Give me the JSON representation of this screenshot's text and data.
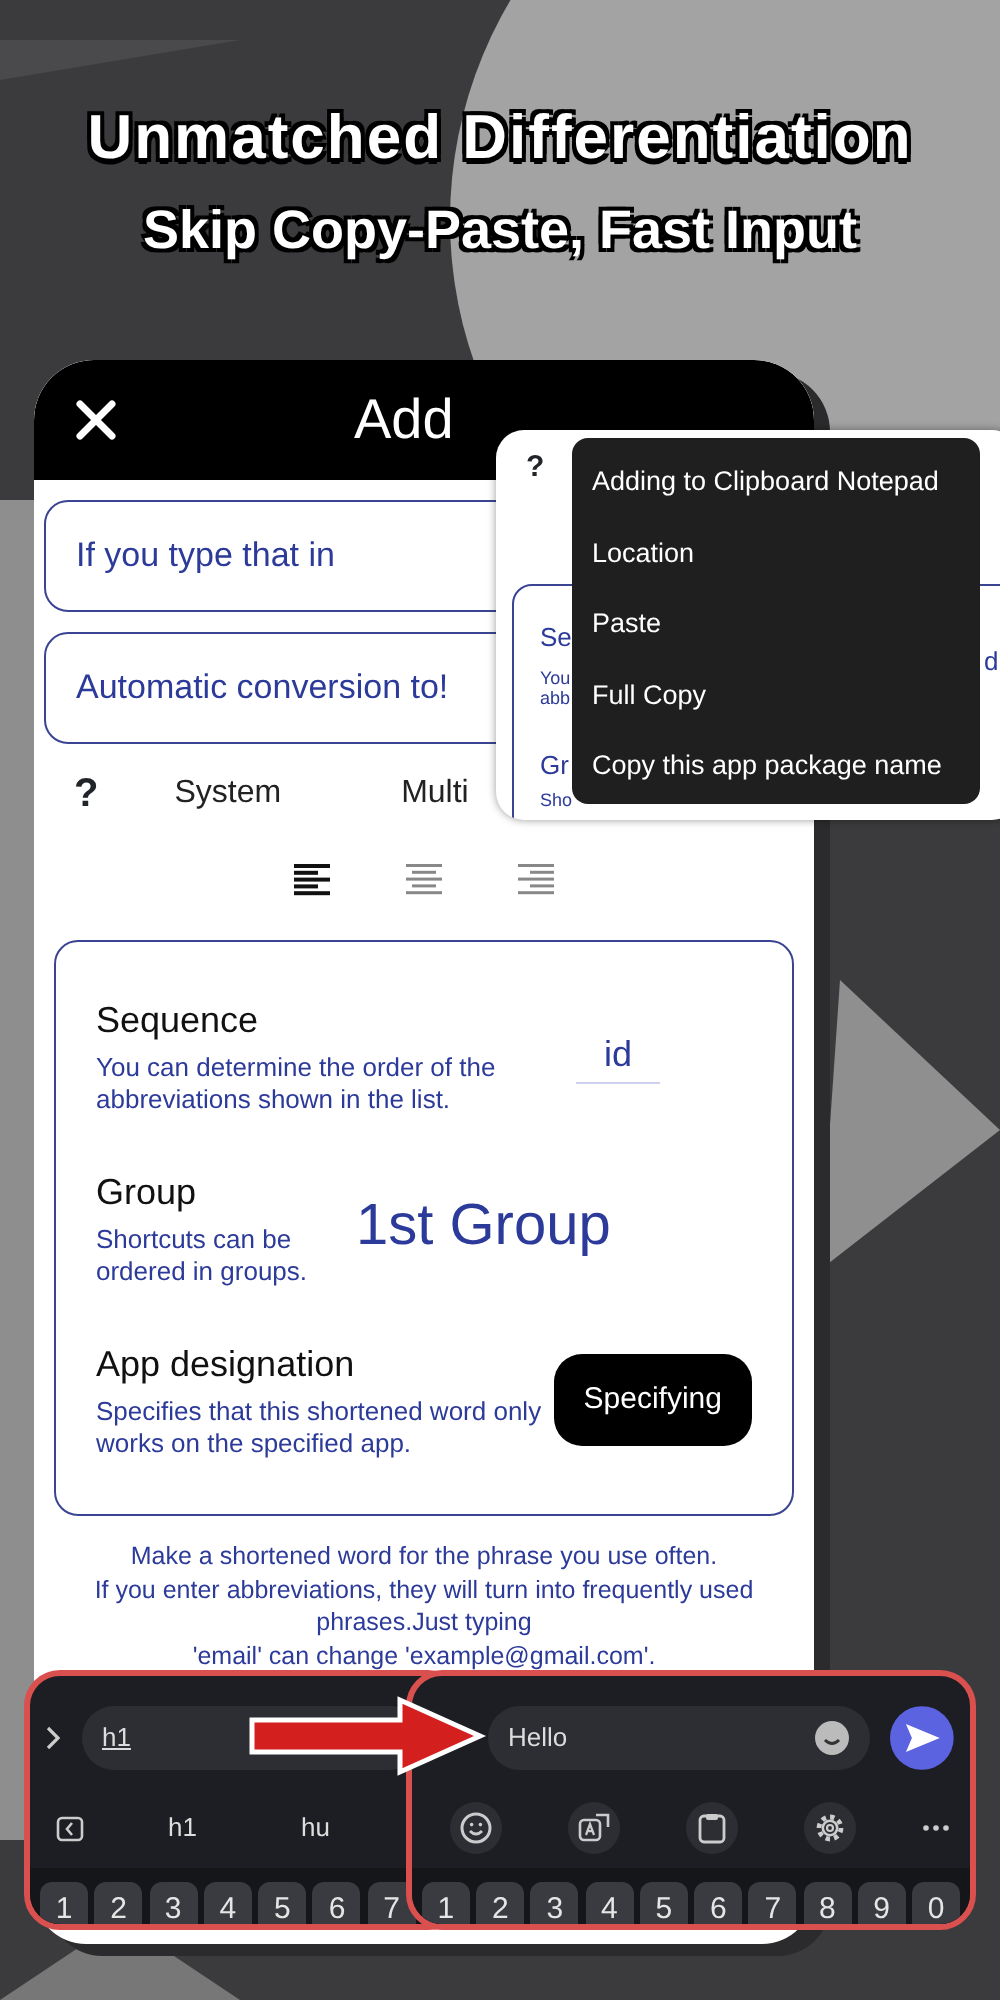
{
  "banner": {
    "title": "Unmatched Differentiation",
    "subtitle": "Skip Copy-Paste, Fast Input"
  },
  "dialog": {
    "title": "Add",
    "fields": [
      {
        "placeholder": "If you type that in"
      },
      {
        "placeholder": "Automatic conversion to!"
      }
    ],
    "help": "?",
    "tabs": [
      {
        "label": "System"
      },
      {
        "label": "Multi"
      }
    ],
    "alignments": [
      {
        "kind": "left",
        "selected": true
      },
      {
        "kind": "center",
        "selected": false
      },
      {
        "kind": "right",
        "selected": false
      }
    ],
    "settings": [
      {
        "kind": "field",
        "title": "Sequence",
        "description": "You can determine the order of the abbreviations shown in the list.",
        "value": "id"
      },
      {
        "kind": "big",
        "title": "Group",
        "description": "Shortcuts can be ordered in groups.",
        "value": "1st Group"
      },
      {
        "kind": "button",
        "title": "App designation",
        "description": "Specifies that this shortened word only works on the specified app.",
        "value": "Specifying"
      }
    ],
    "help_text": "Make a shortened word for the phrase you use often.\nIf you enter abbreviations, they will turn into frequently used phrases.Just typing\n'email' can change 'example@gmail.com'."
  },
  "popup": {
    "help": "?",
    "fragments": [
      "Se",
      "You",
      "abb",
      "Gr",
      "Sho",
      "d"
    ],
    "menu": [
      "Adding to Clipboard Notepad",
      "Location",
      "Paste",
      "Full Copy",
      "Copy this app package name"
    ]
  },
  "keyboards": [
    {
      "kind": "suggest",
      "text": "h1",
      "suggestions": [
        "h1",
        "hu"
      ],
      "keys": [
        "1",
        "2",
        "3",
        "4",
        "5",
        "6",
        "7"
      ]
    },
    {
      "kind": "toolbar",
      "text": "Hello",
      "keys": [
        "1",
        "2",
        "3",
        "4",
        "5",
        "6",
        "7",
        "8",
        "9",
        "0"
      ]
    }
  ]
}
